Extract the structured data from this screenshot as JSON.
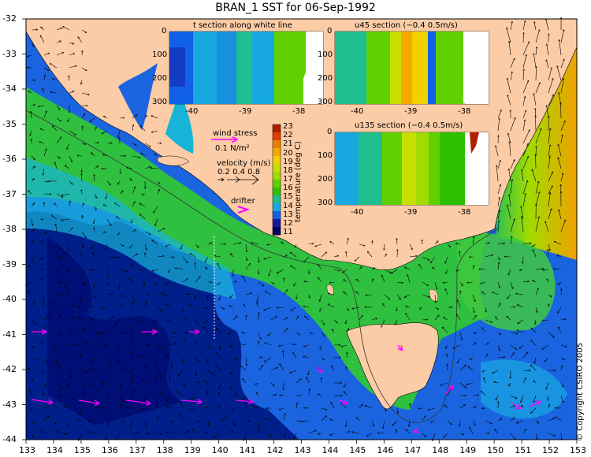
{
  "title": "BRAN_1 SST for 06-Sep-1992",
  "copyright": "© Copyright CSIRO 2005",
  "axes": {
    "lon_ticks": [
      "133",
      "134",
      "135",
      "136",
      "137",
      "138",
      "139",
      "140",
      "141",
      "142",
      "143",
      "144",
      "145",
      "146",
      "147",
      "148",
      "149",
      "150",
      "151",
      "152",
      "153"
    ],
    "lat_ticks": [
      "-32",
      "-33",
      "-34",
      "-35",
      "-36",
      "-37",
      "-38",
      "-39",
      "-40",
      "-41",
      "-42",
      "-43",
      "-44"
    ]
  },
  "legend": {
    "wind_stress_label": "wind stress",
    "wind_stress_value": "0.1 N/m²",
    "velocity_label": "velocity (m/s)",
    "velocity_values": "0.2 0.4 0.8",
    "drifter_label": "drifter"
  },
  "colorbar": {
    "label": "temperature (deg C)",
    "ticks": [
      "23",
      "22",
      "21",
      "20",
      "19",
      "18",
      "17",
      "16",
      "15",
      "14",
      "13",
      "12",
      "11"
    ],
    "colors": [
      "#b01f00",
      "#e23c00",
      "#f07f00",
      "#f5a800",
      "#f0d000",
      "#c8e000",
      "#a0dc00",
      "#60d000",
      "#2ec000",
      "#1fbf90",
      "#18a8e0",
      "#1060e8",
      "#1818a0",
      "#000060"
    ]
  },
  "insets": {
    "t_section": {
      "title": "t section along white line",
      "y_ticks": [
        "0",
        "100",
        "200",
        "300"
      ],
      "x_ticks": [
        "-40",
        "-39",
        "-38"
      ]
    },
    "u45_section": {
      "title": "u45 section (−0.4     0.5m/s)",
      "y_ticks": [
        "0",
        "100",
        "200",
        "300"
      ],
      "x_ticks": [
        "-40",
        "-39",
        "-38"
      ]
    },
    "u135_section": {
      "title": "u135 section (−0.4     0.5m/s)",
      "y_ticks": [
        "0",
        "100",
        "200",
        "300"
      ],
      "x_ticks": [
        "-40",
        "-39",
        "-38"
      ]
    }
  },
  "colors": {
    "land": "#fccca6",
    "ocean_deep": "#001f8a",
    "ocean_cold": "#1a64e0",
    "ocean_mid": "#18b4d8",
    "ocean_warm": "#3cc83c",
    "shelf": "#60d040",
    "drifter": "#ff00ff"
  }
}
